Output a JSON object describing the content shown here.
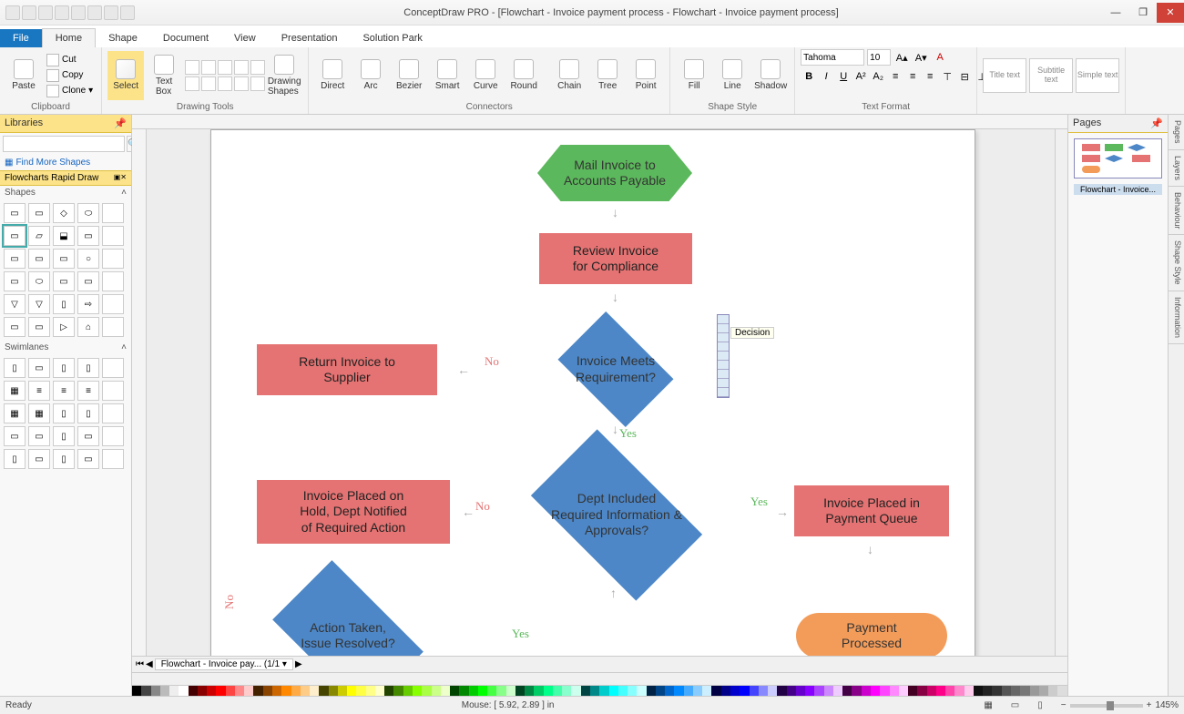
{
  "window": {
    "title": "ConceptDraw PRO - [Flowchart - Invoice payment process - Flowchart - Invoice payment process]"
  },
  "ribbon": {
    "file": "File",
    "tabs": [
      "Home",
      "Shape",
      "Document",
      "View",
      "Presentation",
      "Solution Park"
    ],
    "active": "Home",
    "clipboard": {
      "paste": "Paste",
      "cut": "Cut",
      "copy": "Copy",
      "clone": "Clone",
      "label": "Clipboard"
    },
    "drawing": {
      "select": "Select",
      "textbox": "Text\nBox",
      "shapes": "Drawing\nShapes",
      "label": "Drawing Tools"
    },
    "connectors": {
      "direct": "Direct",
      "arc": "Arc",
      "bezier": "Bezier",
      "smart": "Smart",
      "curve": "Curve",
      "round": "Round",
      "chain": "Chain",
      "tree": "Tree",
      "point": "Point",
      "label": "Connectors"
    },
    "shapestyle": {
      "fill": "Fill",
      "line": "Line",
      "shadow": "Shadow",
      "label": "Shape Style"
    },
    "textfmt": {
      "font": "Tahoma",
      "size": "10",
      "label": "Text Format"
    },
    "textstyles": {
      "title": "Title text",
      "subtitle": "Subtitle text",
      "simple": "Simple text"
    }
  },
  "libraries": {
    "header": "Libraries",
    "findmore": "Find More Shapes",
    "category": "Flowcharts Rapid Draw",
    "shapes_hdr": "Shapes",
    "swimlanes_hdr": "Swimlanes"
  },
  "canvas": {
    "smart_tip": "Decision",
    "page_tab": "Flowchart - Invoice pay...   (1/1",
    "shapes": {
      "start": "Mail Invoice to\nAccounts Payable",
      "review": "Review Invoice\nfor Compliance",
      "meets": "Invoice Meets\nRequirement?",
      "return": "Return Invoice to\nSupplier",
      "deptinfo": "Dept Included\nRequired Information &\nApprovals?",
      "hold": "Invoice Placed on\nHold, Dept Notified\nof Required Action",
      "queue": "Invoice Placed in\nPayment Queue",
      "action": "Action Taken,\nIssue Resolved?",
      "processed": "Payment\nProcessed"
    },
    "labels": {
      "yes": "Yes",
      "no": "No"
    }
  },
  "pages": {
    "header": "Pages",
    "thumb": "Flowchart - Invoice..."
  },
  "sidetabs": [
    "Pages",
    "Layers",
    "Behaviour",
    "Shape Style",
    "Information"
  ],
  "status": {
    "ready": "Ready",
    "mouse": "Mouse: [ 5.92, 2.89 ] in",
    "zoom": "145%"
  },
  "palette": [
    "#000",
    "#444",
    "#888",
    "#bbb",
    "#eee",
    "#fff",
    "#400",
    "#800",
    "#c00",
    "#f00",
    "#f44",
    "#f88",
    "#fcc",
    "#420",
    "#840",
    "#c60",
    "#f80",
    "#fa4",
    "#fc8",
    "#fec",
    "#440",
    "#880",
    "#cc0",
    "#ff0",
    "#ff4",
    "#ff8",
    "#ffc",
    "#240",
    "#480",
    "#6c0",
    "#8f0",
    "#af4",
    "#cf8",
    "#efc",
    "#040",
    "#080",
    "#0c0",
    "#0f0",
    "#4f4",
    "#8f8",
    "#cfc",
    "#042",
    "#084",
    "#0c6",
    "#0f8",
    "#4fa",
    "#8fc",
    "#cfe",
    "#044",
    "#088",
    "#0cc",
    "#0ff",
    "#4ff",
    "#8ff",
    "#cff",
    "#024",
    "#048",
    "#06c",
    "#08f",
    "#4af",
    "#8cf",
    "#cef",
    "#004",
    "#008",
    "#00c",
    "#00f",
    "#44f",
    "#88f",
    "#ccf",
    "#204",
    "#408",
    "#60c",
    "#80f",
    "#a4f",
    "#c8f",
    "#ecf",
    "#404",
    "#808",
    "#c0c",
    "#f0f",
    "#f4f",
    "#f8f",
    "#fcf",
    "#402",
    "#804",
    "#c06",
    "#f08",
    "#f4a",
    "#f8c",
    "#fce",
    "#111",
    "#222",
    "#333",
    "#555",
    "#666",
    "#777",
    "#999",
    "#aaa",
    "#ccc",
    "#ddd"
  ]
}
